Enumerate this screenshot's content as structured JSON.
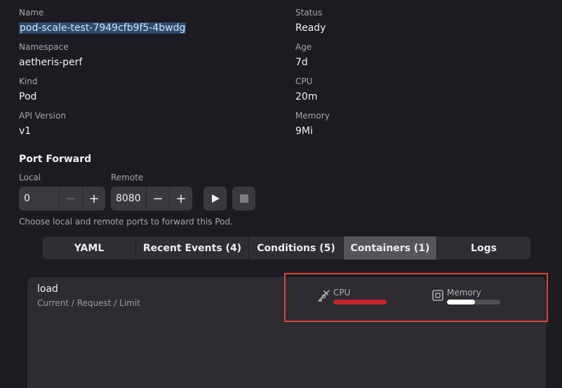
{
  "details": {
    "name": {
      "label": "Name",
      "value": "pod-scale-test-7949cfb9f5-4bwdg"
    },
    "namespace": {
      "label": "Namespace",
      "value": "aetheris-perf"
    },
    "kind": {
      "label": "Kind",
      "value": "Pod"
    },
    "api_version": {
      "label": "API Version",
      "value": "v1"
    },
    "status": {
      "label": "Status",
      "value": "Ready"
    },
    "age": {
      "label": "Age",
      "value": "7d"
    },
    "cpu": {
      "label": "CPU",
      "value": "20m"
    },
    "memory": {
      "label": "Memory",
      "value": "9Mi"
    }
  },
  "port_forward": {
    "title": "Port Forward",
    "local_label": "Local",
    "local_value": "0",
    "remote_label": "Remote",
    "remote_value": "8080",
    "minus": "−",
    "plus": "+",
    "hint": "Choose local and remote ports to forward this Pod."
  },
  "tabs": [
    {
      "label": "YAML"
    },
    {
      "label": "Recent Events (4)"
    },
    {
      "label": "Conditions (5)"
    },
    {
      "label": "Containers (1)"
    },
    {
      "label": "Logs"
    }
  ],
  "active_tab": 3,
  "container": {
    "name": "load",
    "subtitle": "Current / Request / Limit",
    "cpu": {
      "label": "CPU",
      "fill_fraction": 1.0,
      "color": "#c6242c"
    },
    "memory": {
      "label": "Memory",
      "fill_fraction": 0.53,
      "color": "#ffffff"
    }
  },
  "colors": {
    "accent_highlight": "#e0413f",
    "selection": "#2f4c6e"
  }
}
